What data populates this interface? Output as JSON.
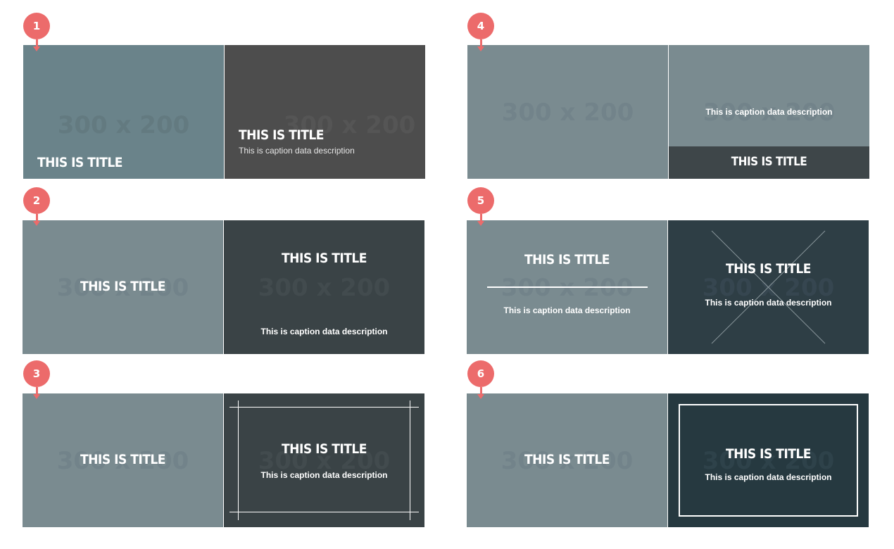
{
  "colors": {
    "badge": "#ec6b6b",
    "slate_light": "#7a8b90",
    "teal_gray": "#6a838a",
    "charcoal": "#4d4d4d",
    "dark_slate": "#3a4346",
    "dark_teal": "#2e3e45",
    "deep_teal": "#263940"
  },
  "placeholder": "300 x 200",
  "groups": [
    {
      "badge": "1",
      "left": {
        "title": "THIS IS TITLE"
      },
      "right": {
        "title": "THIS IS TITLE",
        "caption": "This is caption data description"
      }
    },
    {
      "badge": "2",
      "left": {
        "title": "THIS IS TITLE"
      },
      "right": {
        "title": "THIS IS TITLE",
        "caption": "This is caption data description"
      }
    },
    {
      "badge": "3",
      "left": {
        "title": "THIS IS TITLE"
      },
      "right": {
        "title": "THIS IS TITLE",
        "caption": "This is caption data description"
      }
    },
    {
      "badge": "4",
      "left": {
        "title": ""
      },
      "right": {
        "title": "THIS IS TITLE",
        "caption": "This is caption data description"
      }
    },
    {
      "badge": "5",
      "left": {
        "title": "THIS IS TITLE",
        "caption": "This is caption data description"
      },
      "right": {
        "title": "THIS IS TITLE",
        "caption": "This is caption data description"
      }
    },
    {
      "badge": "6",
      "left": {
        "title": "THIS IS TITLE"
      },
      "right": {
        "title": "THIS IS TITLE",
        "caption": "This is caption data description"
      }
    }
  ]
}
